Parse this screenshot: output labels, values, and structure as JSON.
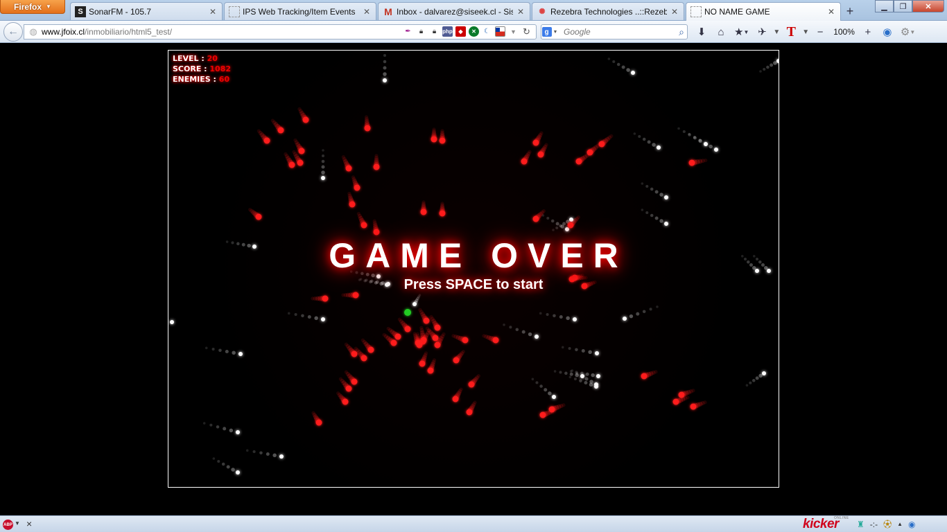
{
  "browser": {
    "menu_button": "Firefox",
    "tabs": [
      {
        "title": "SonarFM - 105.7",
        "favicon": "S",
        "active": false
      },
      {
        "title": "IPS Web Tracking/Item Events",
        "favicon": "",
        "active": false
      },
      {
        "title": "Inbox - dalvarez@siseek.cl - Sise...",
        "favicon": "M",
        "active": false
      },
      {
        "title": "Rezebra Technologies ..::Rezebr...",
        "favicon": "✺",
        "active": false
      },
      {
        "title": "NO NAME GAME",
        "favicon": "",
        "active": true
      }
    ],
    "url": {
      "host": "www.jfoix.cl",
      "path": "/inmobiliario/html5_test/"
    },
    "search_placeholder": "Google",
    "zoom": "100%",
    "addon_brand": "kicker",
    "addon_brand_sub": "ONLINE",
    "addon_status": "-:-"
  },
  "game": {
    "hud": {
      "level_label": "LEVEL :",
      "level_value": "20",
      "score_label": "SCORE :",
      "score_value": "1082",
      "enemies_label": "ENEMIES :",
      "enemies_value": "60"
    },
    "title": "GAME OVER",
    "subtitle": "Press SPACE to start",
    "colors": {
      "enemy": "#ff1a1a",
      "star": "#ffffff",
      "player": "#22cc22"
    }
  }
}
